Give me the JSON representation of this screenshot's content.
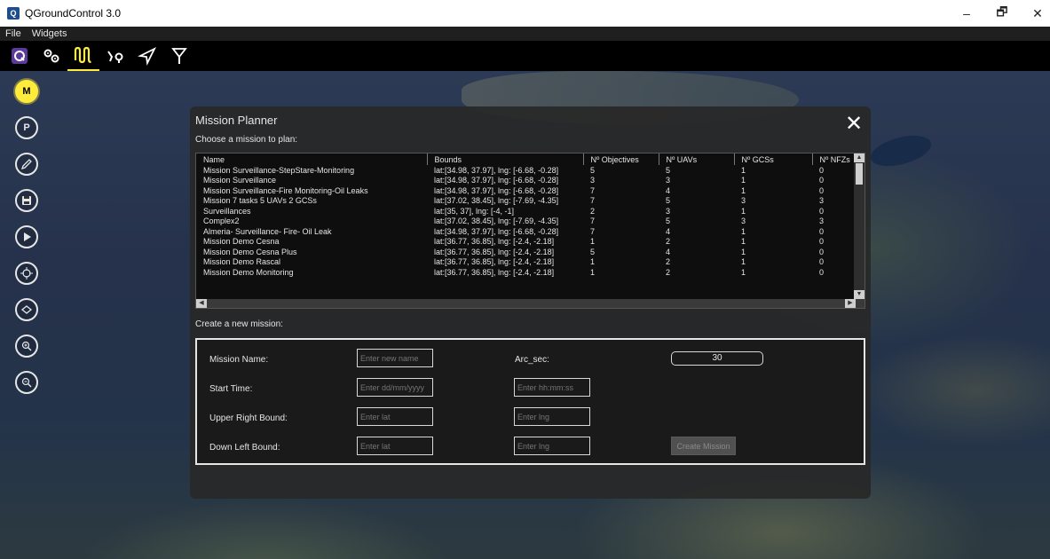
{
  "window": {
    "title": "QGroundControl 3.0",
    "minimize_glyph": "–",
    "maximize_glyph": "🗗",
    "close_glyph": "✕"
  },
  "menubar": {
    "items": [
      "File",
      "Widgets"
    ]
  },
  "toolbar": {
    "icons": [
      "qgc-logo-icon",
      "vehicle-setup-icon",
      "plan-icon",
      "fly-icon",
      "send-icon",
      "antenna-icon"
    ],
    "selected": "plan-icon",
    "accent_color": "#ffeb3b"
  },
  "left_tools": {
    "m_label": "M",
    "p_label": "P",
    "icons": [
      "mission-icon",
      "parking-icon",
      "edit-icon",
      "save-icon",
      "play-icon",
      "target-icon",
      "layers-icon",
      "zoom-in-icon",
      "zoom-out-icon"
    ]
  },
  "dialog": {
    "title": "Mission Planner",
    "close_glyph": "✕",
    "choose_label": "Choose a mission to plan:",
    "columns": [
      "Name",
      "Bounds",
      "Nº Objectives",
      "Nº UAVs",
      "Nº GCSs",
      "Nº NFZs"
    ],
    "rows": [
      [
        "Mission Surveillance-StepStare-Monitoring",
        "lat:[34.98, 37.97], lng: [-6.68, -0.28]",
        "5",
        "5",
        "1",
        "0"
      ],
      [
        "Mission Surveillance",
        "lat:[34.98, 37.97], lng: [-6.68, -0.28]",
        "3",
        "3",
        "1",
        "0"
      ],
      [
        "Mission Surveillance-Fire Monitoring-Oil Leaks",
        "lat:[34.98, 37.97], lng: [-6.68, -0.28]",
        "7",
        "4",
        "1",
        "0"
      ],
      [
        "Mission 7 tasks 5 UAVs 2 GCSs",
        "lat:[37.02, 38.45], lng: [-7.69, -4.35]",
        "7",
        "5",
        "3",
        "3"
      ],
      [
        "Surveillances",
        "lat:[35, 37], lng: [-4, -1]",
        "2",
        "3",
        "1",
        "0"
      ],
      [
        "Complex2",
        "lat:[37.02, 38.45], lng: [-7.69, -4.35]",
        "7",
        "5",
        "3",
        "3"
      ],
      [
        "Almeria- Surveillance- Fire- Oil Leak",
        "lat:[34.98, 37.97], lng: [-6.68, -0.28]",
        "7",
        "4",
        "1",
        "0"
      ],
      [
        "Mission Demo Cesna",
        "lat:[36.77, 36.85], lng: [-2.4, -2.18]",
        "1",
        "2",
        "1",
        "0"
      ],
      [
        "Mission Demo Cesna Plus",
        "lat:[36.77, 36.85], lng: [-2.4, -2.18]",
        "5",
        "4",
        "1",
        "0"
      ],
      [
        "Mission Demo Rascal",
        "lat:[36.77, 36.85], lng: [-2.4, -2.18]",
        "1",
        "2",
        "1",
        "0"
      ],
      [
        "Mission Demo Monitoring",
        "lat:[36.77, 36.85], lng: [-2.4, -2.18]",
        "1",
        "2",
        "1",
        "0"
      ]
    ],
    "create_label": "Create a new mission:",
    "form": {
      "mission_name_label": "Mission Name:",
      "mission_name_placeholder": "Enter new name",
      "arc_sec_label": "Arc_sec:",
      "arc_sec_value": "30",
      "start_time_label": "Start Time:",
      "date_placeholder": "Enter dd/mm/yyyy",
      "time_placeholder": "Enter hh:mm:ss",
      "upper_right_label": "Upper Right Bound:",
      "down_left_label": "Down Left Bound:",
      "lat_placeholder": "Enter lat",
      "lng_placeholder": "Enter lng",
      "create_button": "Create Mission"
    }
  }
}
